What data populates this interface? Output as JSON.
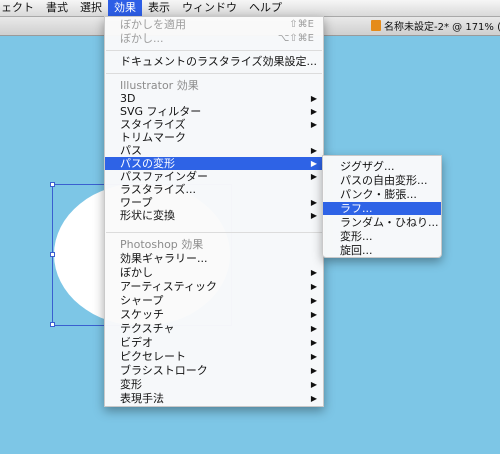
{
  "menubar": {
    "items": [
      "ェクト",
      "書式",
      "選択",
      "効果",
      "表示",
      "ウィンドウ",
      "ヘルプ"
    ]
  },
  "document": {
    "title": "名称未設定-2* @ 171% (RG"
  },
  "effect_menu": {
    "apply_last": "ぼかしを適用",
    "apply_last_shortcut": "⇧⌘E",
    "last_effect": "ぼかし...",
    "last_effect_shortcut": "⌥⇧⌘E",
    "raster_settings": "ドキュメントのラスタライズ効果設定...",
    "illustrator_header": "Illustrator 効果",
    "illustrator_items": [
      "3D",
      "SVG フィルター",
      "スタイライズ",
      "トリムマーク",
      "パス",
      "パスの変形",
      "パスファインダー",
      "ラスタライズ...",
      "ワープ",
      "形状に変換"
    ],
    "photoshop_header": "Photoshop 効果",
    "photoshop_items": [
      "効果ギャラリー...",
      "ぼかし",
      "アーティスティック",
      "シャープ",
      "スケッチ",
      "テクスチャ",
      "ビデオ",
      "ピクセレート",
      "ブラシストローク",
      "変形",
      "表現手法"
    ]
  },
  "distort_submenu": {
    "items": [
      "ジグザグ...",
      "パスの自由変形...",
      "パンク・膨張...",
      "ラフ...",
      "ランダム・ひねり...",
      "変形...",
      "旋回..."
    ]
  },
  "colors": {
    "canvas": "#7dc6e6",
    "highlight": "#2e63e6"
  }
}
